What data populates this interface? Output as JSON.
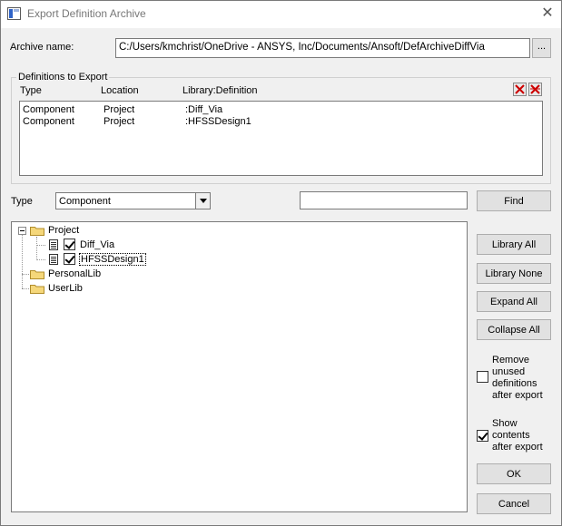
{
  "window": {
    "title": "Export Definition Archive",
    "close_glyph": "✕"
  },
  "archive": {
    "label": "Archive name:",
    "value": "C:/Users/kmchrist/OneDrive - ANSYS, Inc/Documents/Ansoft/DefArchiveDiffVia",
    "browse_label": "..."
  },
  "definitions": {
    "legend": "Definitions to Export",
    "columns": [
      "Type",
      "Location",
      "Library:Definition"
    ],
    "rows": [
      {
        "type": "Component",
        "location": "Project",
        "definition": ":Diff_Via"
      },
      {
        "type": "Component",
        "location": "Project",
        "definition": ":HFSSDesign1"
      }
    ],
    "colors": {
      "delete_red": "#cc0000"
    }
  },
  "filter": {
    "type_label": "Type",
    "type_value": "Component",
    "search_value": "",
    "find_label": "Find"
  },
  "tree": {
    "project": "Project",
    "children": [
      {
        "label": "Diff_Via",
        "checked": true
      },
      {
        "label": "HFSSDesign1",
        "checked": true
      }
    ],
    "personal": "PersonalLib",
    "user": "UserLib"
  },
  "buttons": {
    "library_all": "Library All",
    "library_none": "Library None",
    "expand_all": "Expand All",
    "collapse_all": "Collapse All",
    "ok": "OK",
    "cancel": "Cancel"
  },
  "options": {
    "remove_unused": {
      "line1": "Remove",
      "line2": "unused",
      "line3": "definitions",
      "line4": "after export",
      "checked": false
    },
    "show_contents": {
      "line1": "Show",
      "line2": "contents",
      "line3": "after export",
      "checked": true
    }
  }
}
